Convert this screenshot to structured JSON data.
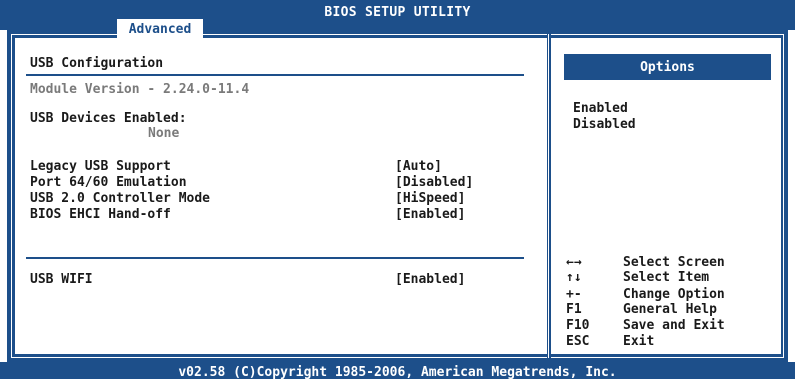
{
  "header": {
    "title": "BIOS SETUP UTILITY",
    "active_tab": "Advanced"
  },
  "main": {
    "section_title": "USB Configuration",
    "module_version": "Module Version - 2.24.0-11.4",
    "devices_label": "USB Devices Enabled:",
    "devices_value": "None",
    "settings": [
      {
        "label": "Legacy USB Support",
        "value": "[Auto]"
      },
      {
        "label": "Port 64/60 Emulation",
        "value": "[Disabled]"
      },
      {
        "label": "USB 2.0 Controller Mode",
        "value": "[HiSpeed]"
      },
      {
        "label": "BIOS EHCI Hand-off",
        "value": "[Enabled]"
      }
    ],
    "wifi": {
      "label": "USB WIFI",
      "value": "[Enabled]"
    }
  },
  "options": {
    "header": "Options",
    "items": [
      "Enabled",
      "Disabled"
    ]
  },
  "help": [
    {
      "key": "←→",
      "desc": "Select Screen"
    },
    {
      "key": "↑↓",
      "desc": "Select Item"
    },
    {
      "key": "+-",
      "desc": "Change Option"
    },
    {
      "key": "F1",
      "desc": "General Help"
    },
    {
      "key": "F10",
      "desc": "Save and Exit"
    },
    {
      "key": "ESC",
      "desc": "Exit"
    }
  ],
  "footer": {
    "copyright": "v02.58 (C)Copyright 1985-2006, American Megatrends, Inc."
  },
  "colors": {
    "frame_blue": "#1d4f8a",
    "disabled_gray": "#7a7a7a"
  }
}
